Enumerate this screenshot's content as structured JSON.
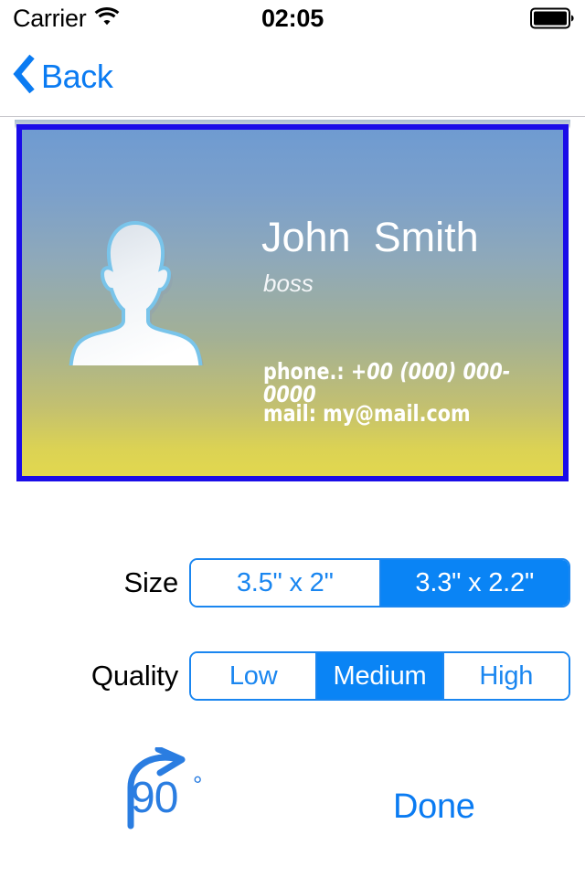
{
  "status_bar": {
    "carrier": "Carrier",
    "time": "02:05",
    "wifi_icon": "wifi-icon",
    "battery_icon": "battery-full-icon"
  },
  "nav_bar": {
    "back_label": "Back",
    "back_icon": "chevron-left-icon"
  },
  "card": {
    "name": "John  Smith",
    "title": "boss",
    "phone_label": "phone.: ",
    "phone_value": "+00 (000) 000-0000",
    "mail": "mail: my@mail.com",
    "avatar_icon": "person-silhouette-icon",
    "border_color": "#1a0ce8",
    "gradient_top_color": "#6f9bd1",
    "gradient_bottom_color": "#e2d84f"
  },
  "settings": {
    "size": {
      "label": "Size",
      "options": [
        {
          "label": "3.5\" x 2\"",
          "selected": false
        },
        {
          "label": "3.3\" x 2.2\"",
          "selected": true
        }
      ]
    },
    "quality": {
      "label": "Quality",
      "options": [
        {
          "label": "Low",
          "selected": false
        },
        {
          "label": "Medium",
          "selected": true
        },
        {
          "label": "High",
          "selected": false
        }
      ]
    }
  },
  "actions": {
    "rotate_value": "90",
    "rotate_degree_sign": "°",
    "rotate_icon": "rotate-clockwise-arrow-icon",
    "done_label": "Done"
  },
  "colors": {
    "accent_blue": "#0a7bf2",
    "segment_blue": "#0a84f5",
    "segment_border": "#1a86f0"
  }
}
